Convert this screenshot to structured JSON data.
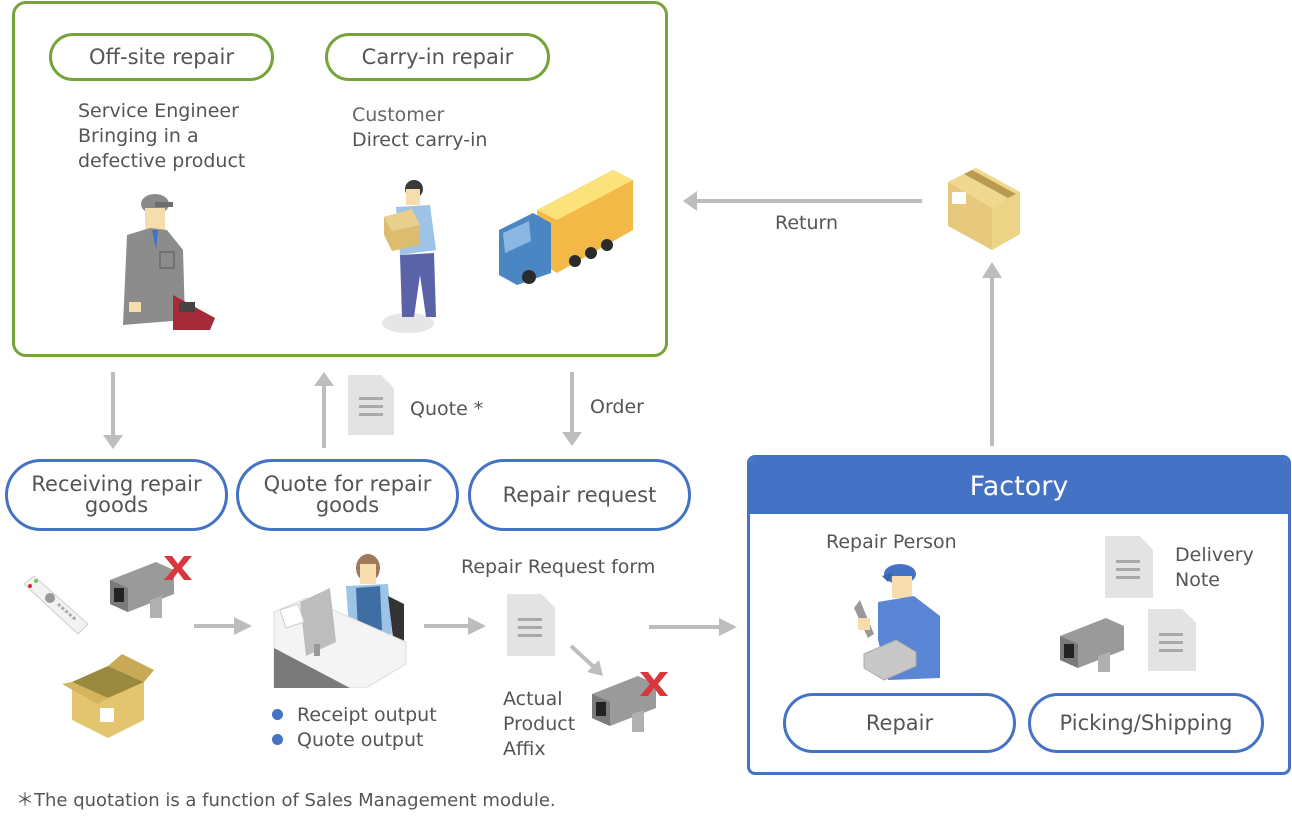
{
  "top_panel": {
    "offsite_label": "Off-site repair",
    "carryin_label": "Carry-in repair",
    "offsite_desc": "Service Engineer\nBringing in a\ndefective product",
    "carryin_desc_line1": "Customer",
    "carryin_desc_line2": "Direct carry-in",
    "icons": [
      "service-engineer-figure",
      "customer-with-box-figure",
      "delivery-truck"
    ]
  },
  "flow_labels": {
    "quote": "Quote *",
    "order": "Order",
    "return": "Return"
  },
  "process_steps": [
    {
      "label": "Receiving repair\ngoods"
    },
    {
      "label": "Quote for repair\ngoods"
    },
    {
      "label": "Repair request"
    }
  ],
  "reception": {
    "outputs": [
      "Receipt output",
      "Quote output"
    ],
    "form_label": "Repair Request form",
    "affix_label": "Actual\nProduct\nAffix"
  },
  "factory": {
    "title": "Factory",
    "repair_person_label": "Repair Person",
    "delivery_note_label": "Delivery\nNote",
    "steps": [
      "Repair",
      "Picking/Shipping"
    ]
  },
  "footnote": "＊The quotation is a function of Sales Management module.",
  "colors": {
    "green_accent": "#76a33a",
    "blue_accent": "#4472c4",
    "arrow_gray": "#bdbdbd",
    "defect_red": "#d9363e"
  }
}
